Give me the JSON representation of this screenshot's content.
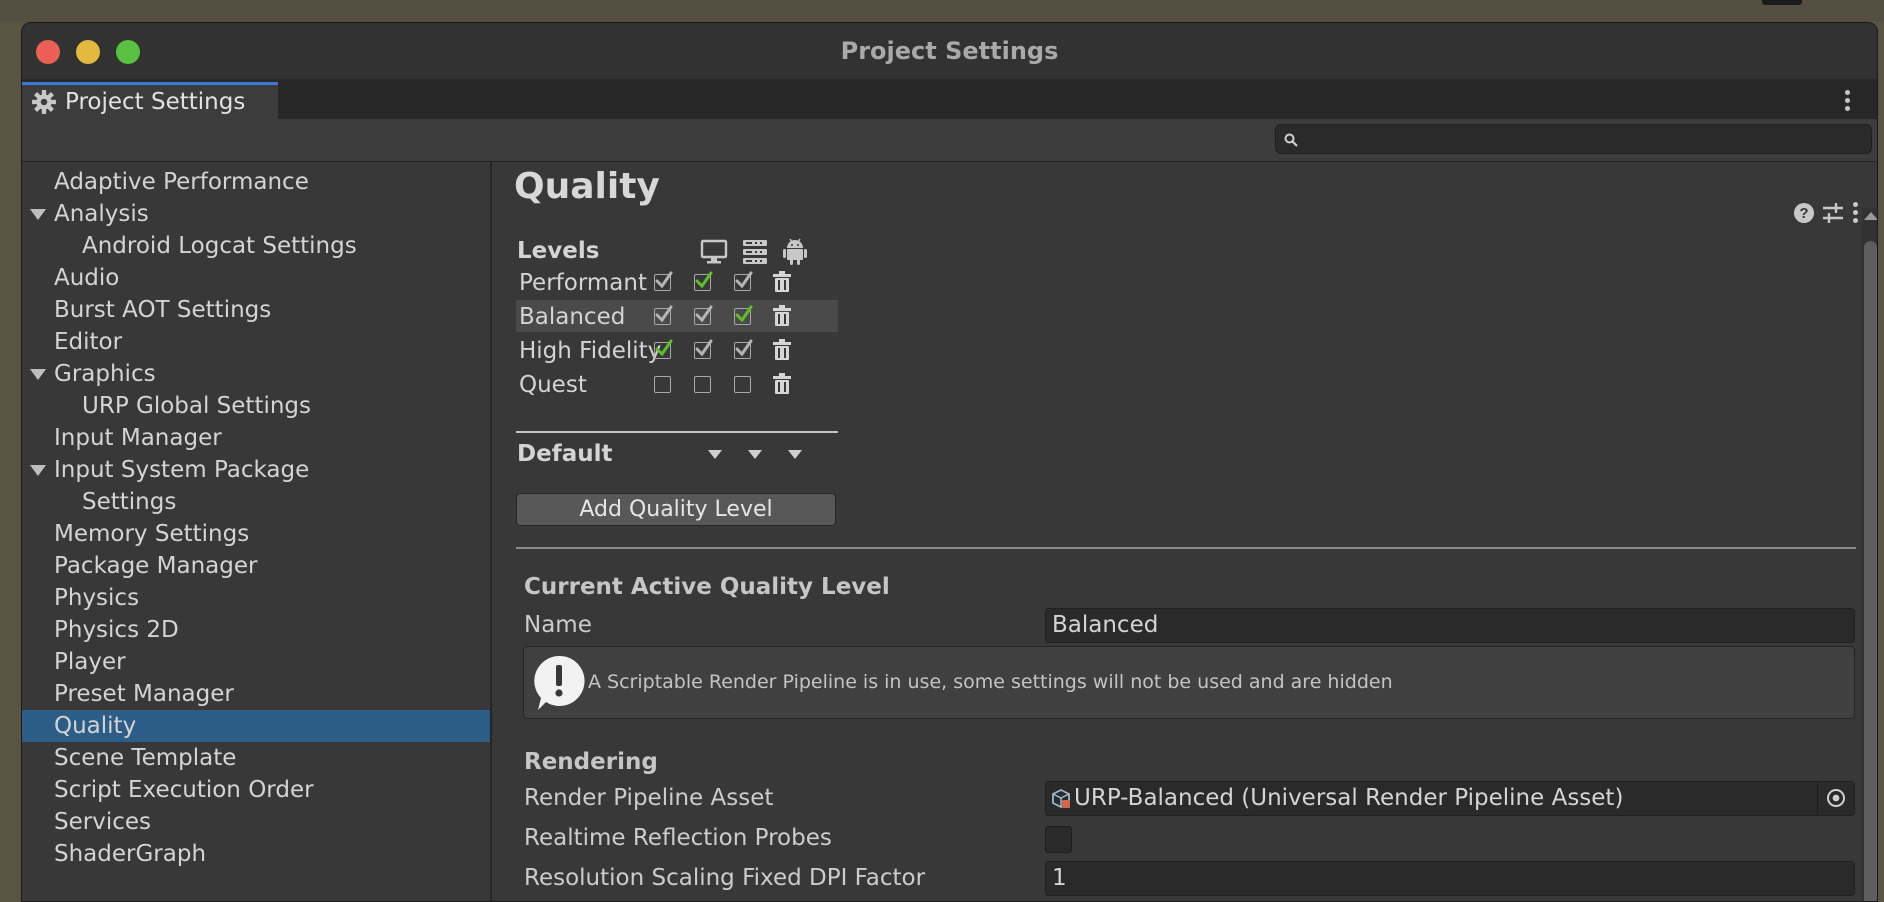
{
  "window": {
    "title": "Project Settings",
    "tab_label": "Project Settings",
    "search": {
      "value": "",
      "placeholder": ""
    }
  },
  "sidebar": {
    "selected": "Quality",
    "items": [
      {
        "label": "Adaptive Performance",
        "indent": 1,
        "expandable": false
      },
      {
        "label": "Analysis",
        "indent": 1,
        "expandable": true
      },
      {
        "label": "Android Logcat Settings",
        "indent": 2,
        "expandable": false
      },
      {
        "label": "Audio",
        "indent": 1,
        "expandable": false
      },
      {
        "label": "Burst AOT Settings",
        "indent": 1,
        "expandable": false
      },
      {
        "label": "Editor",
        "indent": 1,
        "expandable": false
      },
      {
        "label": "Graphics",
        "indent": 1,
        "expandable": true
      },
      {
        "label": "URP Global Settings",
        "indent": 2,
        "expandable": false
      },
      {
        "label": "Input Manager",
        "indent": 1,
        "expandable": false
      },
      {
        "label": "Input System Package",
        "indent": 1,
        "expandable": true
      },
      {
        "label": "Settings",
        "indent": 2,
        "expandable": false
      },
      {
        "label": "Memory Settings",
        "indent": 1,
        "expandable": false
      },
      {
        "label": "Package Manager",
        "indent": 1,
        "expandable": false
      },
      {
        "label": "Physics",
        "indent": 1,
        "expandable": false
      },
      {
        "label": "Physics 2D",
        "indent": 1,
        "expandable": false
      },
      {
        "label": "Player",
        "indent": 1,
        "expandable": false
      },
      {
        "label": "Preset Manager",
        "indent": 1,
        "expandable": false
      },
      {
        "label": "Quality",
        "indent": 1,
        "expandable": false
      },
      {
        "label": "Scene Template",
        "indent": 1,
        "expandable": false
      },
      {
        "label": "Script Execution Order",
        "indent": 1,
        "expandable": false
      },
      {
        "label": "Services",
        "indent": 1,
        "expandable": false
      },
      {
        "label": "ShaderGraph",
        "indent": 1,
        "expandable": false
      }
    ]
  },
  "quality": {
    "title": "Quality",
    "levels_label": "Levels",
    "platforms": [
      "desktop-icon",
      "server-icon",
      "android-icon"
    ],
    "levels": [
      {
        "name": "Performant",
        "checks": [
          true,
          true,
          true
        ],
        "default_col": 1,
        "selected": false
      },
      {
        "name": "Balanced",
        "checks": [
          true,
          true,
          true
        ],
        "default_col": 2,
        "selected": true
      },
      {
        "name": "High Fidelity",
        "checks": [
          true,
          true,
          true
        ],
        "default_col": 0,
        "selected": false
      },
      {
        "name": "Quest",
        "checks": [
          false,
          false,
          false
        ],
        "default_col": -1,
        "selected": false
      }
    ],
    "default_label": "Default",
    "add_button": "Add Quality Level"
  },
  "current": {
    "section_title": "Current Active Quality Level",
    "name_label": "Name",
    "name_value": "Balanced",
    "help_text": "A Scriptable Render Pipeline is in use, some settings will not be used and are hidden"
  },
  "rendering": {
    "section_title": "Rendering",
    "pipeline_label": "Render Pipeline Asset",
    "pipeline_value": "URP-Balanced (Universal Render Pipeline Asset)",
    "reflection_label": "Realtime Reflection Probes",
    "reflection_checked": false,
    "dpi_label": "Resolution Scaling Fixed DPI Factor",
    "dpi_value": "1"
  },
  "colors": {
    "selection": "#2c5d87",
    "check_green": "#5fbf2a",
    "check_gray": "#b4b4b4",
    "accent_tab": "#3b7bd4"
  }
}
